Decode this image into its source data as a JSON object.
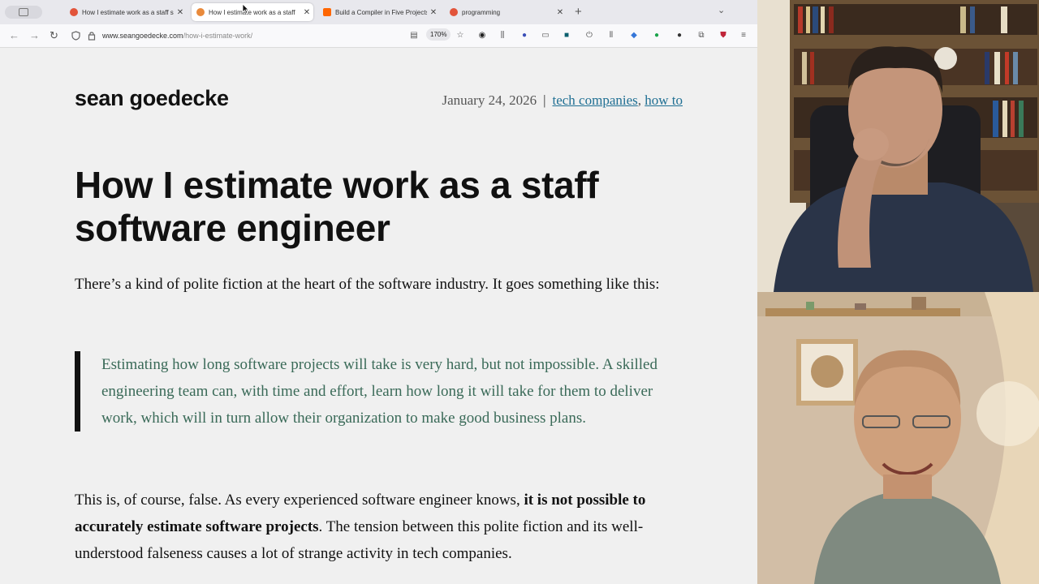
{
  "tabs": [
    {
      "title": "How I estimate work as a staff s",
      "favicon": "reddit-icon",
      "color": "#e2543a",
      "active": false
    },
    {
      "title": "How I estimate work as a staff",
      "favicon": "fox-icon",
      "color": "#e98a3b",
      "active": true
    },
    {
      "title": "Build a Compiler in Five Projects",
      "favicon": "y-combinator-icon",
      "color": "#ff6600",
      "active": false
    },
    {
      "title": "programming",
      "favicon": "reddit-icon",
      "color": "#e2543a",
      "active": false
    }
  ],
  "navbar": {
    "url_domain": "www.seangoedecke.com",
    "url_path": "/how-i-estimate-work/",
    "zoom": "170%"
  },
  "article": {
    "site_title": "sean goedecke",
    "date": "January 24, 2026",
    "separator": "|",
    "tags": [
      "tech companies",
      "how to"
    ],
    "tag_comma": ",",
    "title": "How I estimate work as a staff software engineer",
    "p1": "There’s a kind of polite fiction at the heart of the software industry. It goes something like this:",
    "quote": "Estimating how long software projects will take is very hard, but not impossible. A skilled engineering team can, with time and effort, learn how long it will take for them to deliver work, which will in turn allow their organization to make good business plans.",
    "p3_a": "This is, of course, false. As every experienced software engineer knows, ",
    "p3_bold": "it is not possible to accurately estimate software projects",
    "p3_b": ". The tension between this polite fiction and its well-understood falseness causes a lot of strange activity in tech companies."
  },
  "colors": {
    "link": "#1f6f93",
    "quote_text": "#3a6a58",
    "page_bg": "#f0f0f0"
  },
  "icons": [
    "back-icon",
    "forward-icon",
    "reload-icon",
    "shield-icon",
    "lock-icon",
    "reader-view-icon",
    "bookmark-star-icon",
    "menu-icon",
    "extensions-icon"
  ]
}
